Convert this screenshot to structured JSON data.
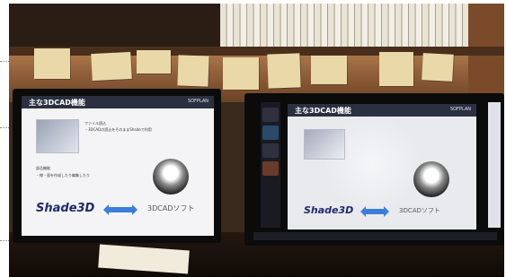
{
  "photo": {
    "left_monitor": {
      "slide_title": "主な3DCAD機能",
      "logo_text": "SOFPLAN",
      "fine_text_1": "ファイル読込",
      "fine_text_2": "・3DCADの読込をそのままShadeで利用",
      "fine_text_3": "部品機能",
      "fine_text_4": "・線・面を作成したり編集したり",
      "brand": "Shade3D",
      "cad_label": "3DCADソフト"
    },
    "right_monitor": {
      "slide_title": "主な3DCAD機能",
      "logo_text": "SOFPLAN",
      "brand": "Shade3D",
      "cad_label": "3DCADソフト"
    },
    "colors": {
      "slide_header": "#2b3040",
      "arrow": "#3b7fd8",
      "brand": "#1e2a6e"
    }
  }
}
